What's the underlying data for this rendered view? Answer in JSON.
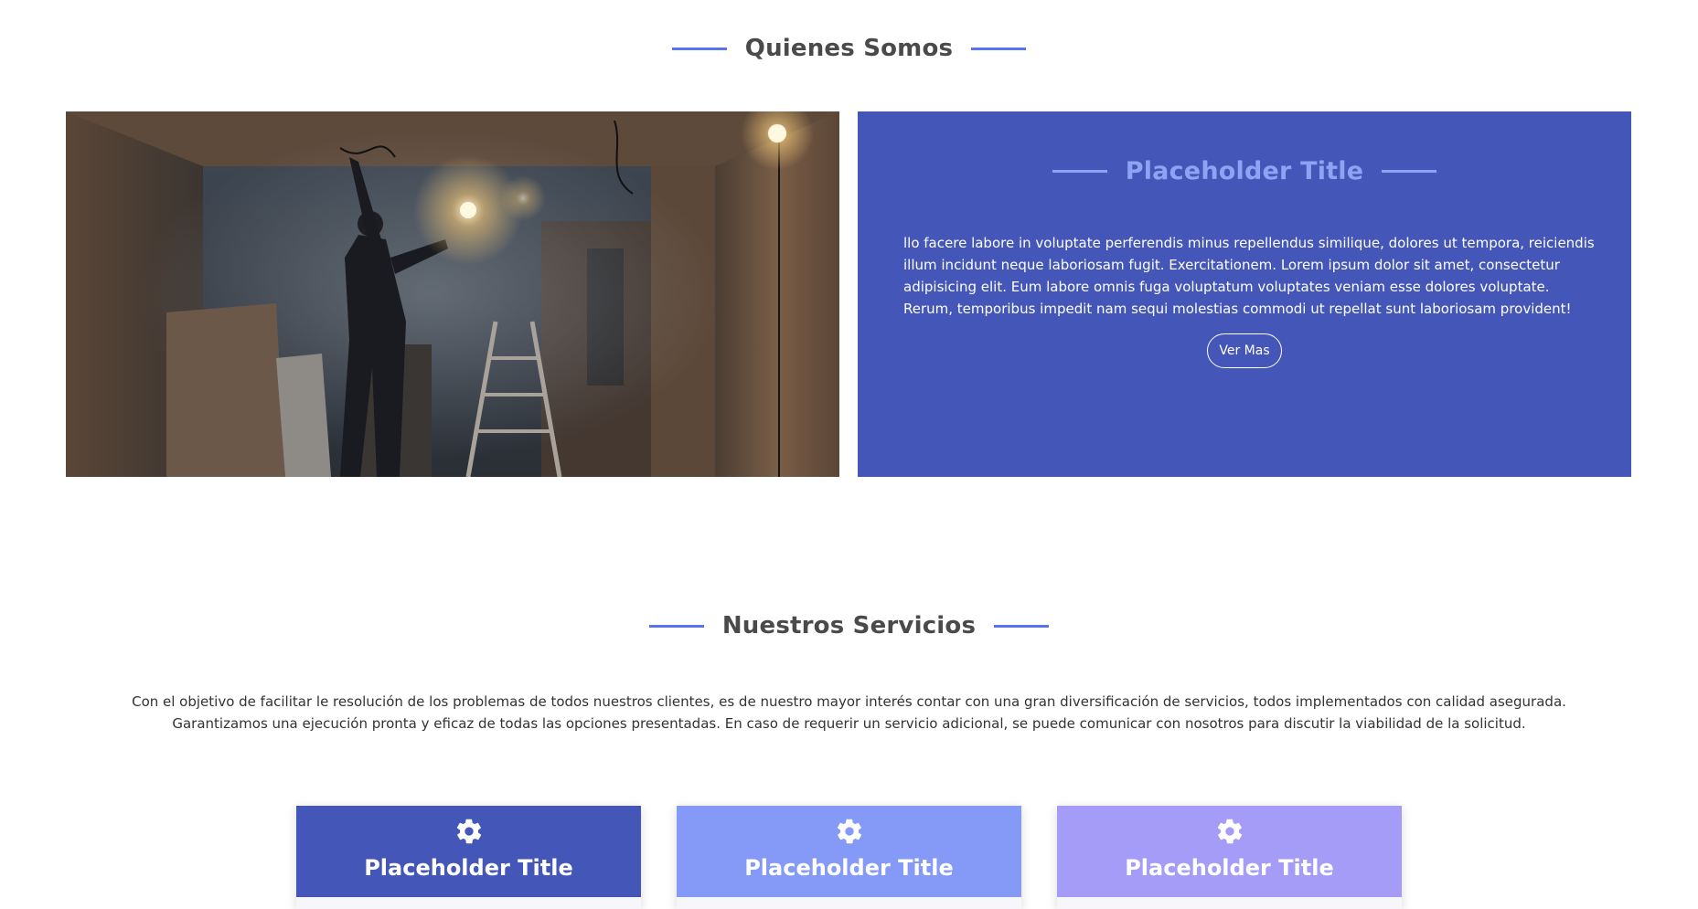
{
  "about": {
    "heading": "Quienes Somos",
    "panel": {
      "title": "Placeholder Title",
      "text": "llo facere labore in voluptate perferendis minus repellendus similique, dolores ut tempora, reiciendis illum incidunt neque laboriosam fugit. Exercitationem. Lorem ipsum dolor sit amet, consectetur adipisicing elit. Eum labore omnis fuga voluptatum voluptates veniam esse dolores voluptate. Rerum, temporibus impedit nam sequi molestias commodi ut repellat sunt laboriosam provident!",
      "button_label": "Ver Mas",
      "background_color": "#4456b8",
      "title_color": "#8fa2f3"
    }
  },
  "services": {
    "heading": "Nuestros Servicios",
    "description_line1": "Con el objetivo de facilitar le resolución de los problemas de todos nuestros clientes, es de nuestro mayor interés contar con una gran diversificación de servicios, todos implementados con calidad asegurada.",
    "description_line2": "Garantizamos una ejecución pronta y eficaz de todas las opciones presentadas. En caso de requerir un servicio adicional, se puede comunicar con nosotros para discutir la viabilidad de la solicitud.",
    "cards": [
      {
        "title": "Placeholder Title",
        "icon": "gear-icon",
        "color": "#4456b8"
      },
      {
        "title": "Placeholder Title",
        "icon": "gear-icon",
        "color": "#8599f7"
      },
      {
        "title": "Placeholder Title",
        "icon": "gear-icon",
        "color": "#a59cf7"
      }
    ]
  },
  "colors": {
    "accent_line": "#5b73e8",
    "heading_text": "#4a4a4a"
  }
}
